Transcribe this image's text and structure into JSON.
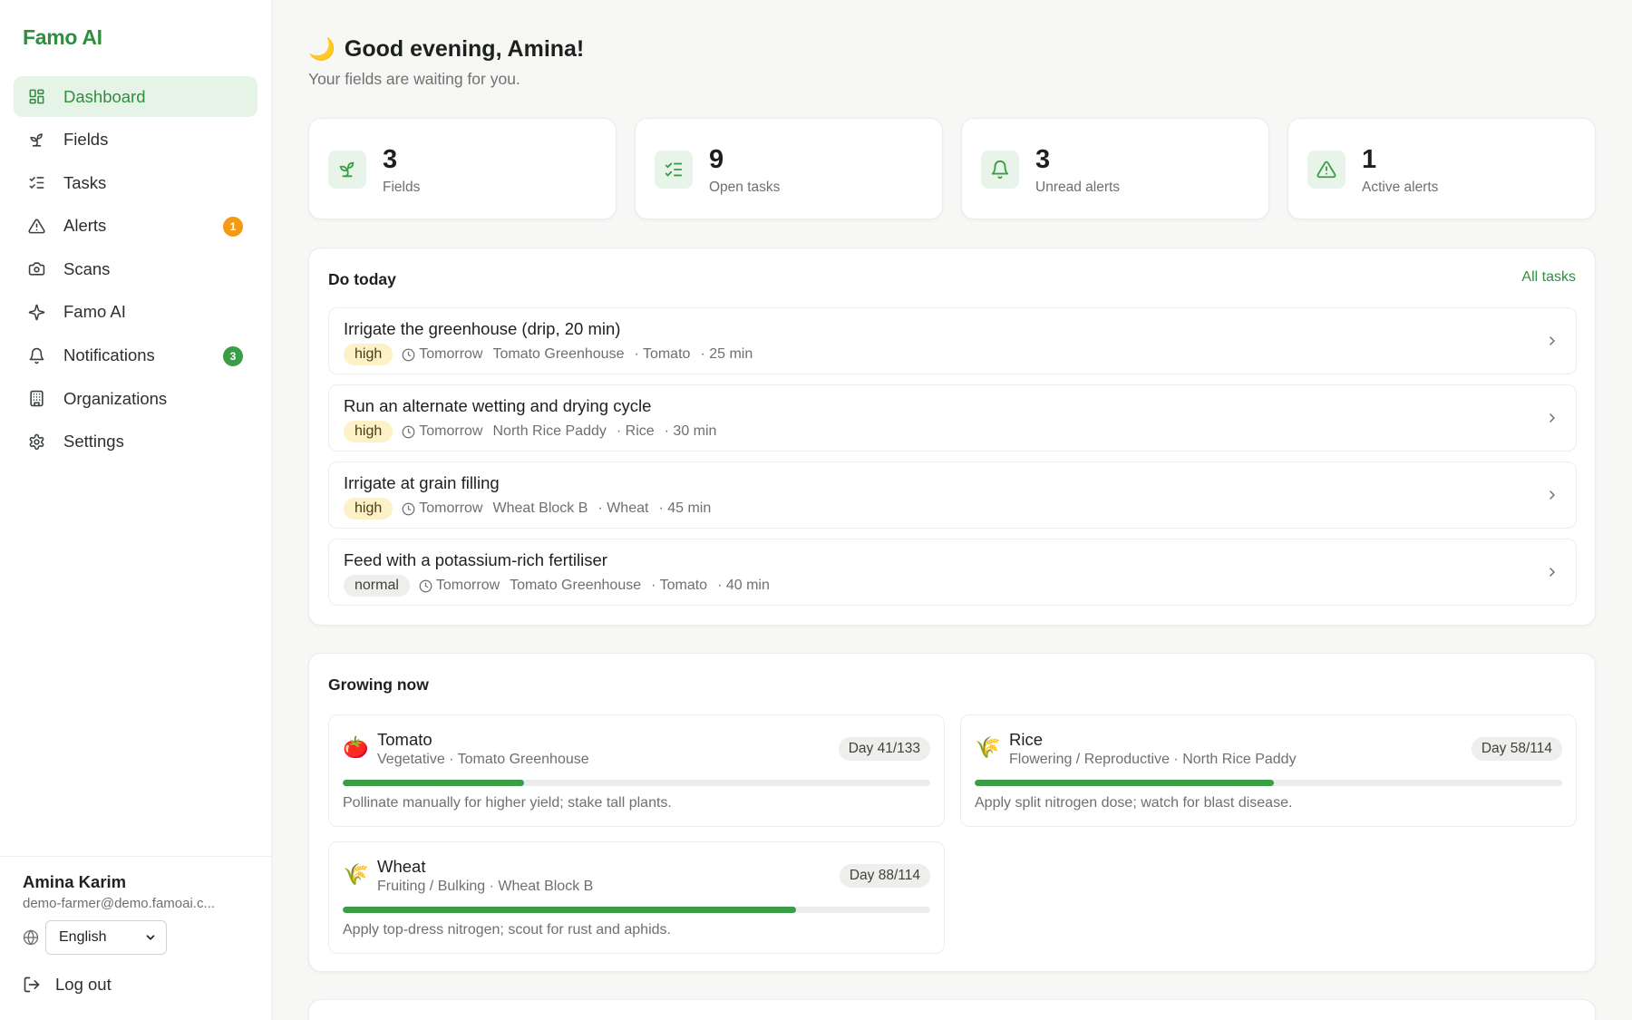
{
  "app": {
    "brand": "Famo AI"
  },
  "sidebar": {
    "items": [
      {
        "label": "Dashboard",
        "icon": "dashboard-icon",
        "active": true
      },
      {
        "label": "Fields",
        "icon": "sprout-icon"
      },
      {
        "label": "Tasks",
        "icon": "checklist-icon"
      },
      {
        "label": "Alerts",
        "icon": "warning-icon",
        "badge": "1"
      },
      {
        "label": "Scans",
        "icon": "camera-icon"
      },
      {
        "label": "Famo AI",
        "icon": "sparkles-icon"
      },
      {
        "label": "Notifications",
        "icon": "bell-icon",
        "badge": "3"
      },
      {
        "label": "Organizations",
        "icon": "building-icon"
      },
      {
        "label": "Settings",
        "icon": "gear-icon"
      }
    ]
  },
  "user": {
    "name": "Amina Karim",
    "email": "demo-farmer@demo.famoai.c...",
    "language": "English",
    "logout_label": "Log out"
  },
  "header": {
    "greeting": "Good evening, Amina!",
    "greeting_icon": "🌙",
    "subtitle": "Your fields are waiting for you."
  },
  "stats": [
    {
      "value": "3",
      "label": "Fields",
      "icon": "sprout-icon"
    },
    {
      "value": "9",
      "label": "Open tasks",
      "icon": "checklist-icon"
    },
    {
      "value": "3",
      "label": "Unread alerts",
      "icon": "bell-icon"
    },
    {
      "value": "1",
      "label": "Active alerts",
      "icon": "warning-icon"
    }
  ],
  "today": {
    "title": "Do today",
    "link": "All tasks",
    "tasks": [
      {
        "title": "Irrigate the greenhouse (drip, 20 min)",
        "priority": "high",
        "when": "Tomorrow",
        "field": "Tomato Greenhouse",
        "crop": "· Tomato",
        "duration": "· 25 min"
      },
      {
        "title": "Run an alternate wetting and drying cycle",
        "priority": "high",
        "when": "Tomorrow",
        "field": "North Rice Paddy",
        "crop": "· Rice",
        "duration": "· 30 min"
      },
      {
        "title": "Irrigate at grain filling",
        "priority": "high",
        "when": "Tomorrow",
        "field": "Wheat Block B",
        "crop": "· Wheat",
        "duration": "· 45 min"
      },
      {
        "title": "Feed with a potassium-rich fertiliser",
        "priority": "normal",
        "when": "Tomorrow",
        "field": "Tomato Greenhouse",
        "crop": "· Tomato",
        "duration": "· 40 min"
      }
    ]
  },
  "growing": {
    "title": "Growing now",
    "crops": [
      {
        "name": "Tomato",
        "emoji": "🍅",
        "desc": "Vegetative · Tomato Greenhouse",
        "day": "Day 41/133",
        "progress": 0.308,
        "tip": "Pollinate manually for higher yield; stake tall plants."
      },
      {
        "name": "Rice",
        "emoji": "🌾",
        "desc": "Flowering / Reproductive · North Rice Paddy",
        "day": "Day 58/114",
        "progress": 0.509,
        "tip": "Apply split nitrogen dose; watch for blast disease."
      },
      {
        "name": "Wheat",
        "emoji": "🌾",
        "desc": "Fruiting / Bulking · Wheat Block B",
        "day": "Day 88/114",
        "progress": 0.772,
        "tip": "Apply top-dress nitrogen; scout for rust and aphids."
      }
    ]
  }
}
